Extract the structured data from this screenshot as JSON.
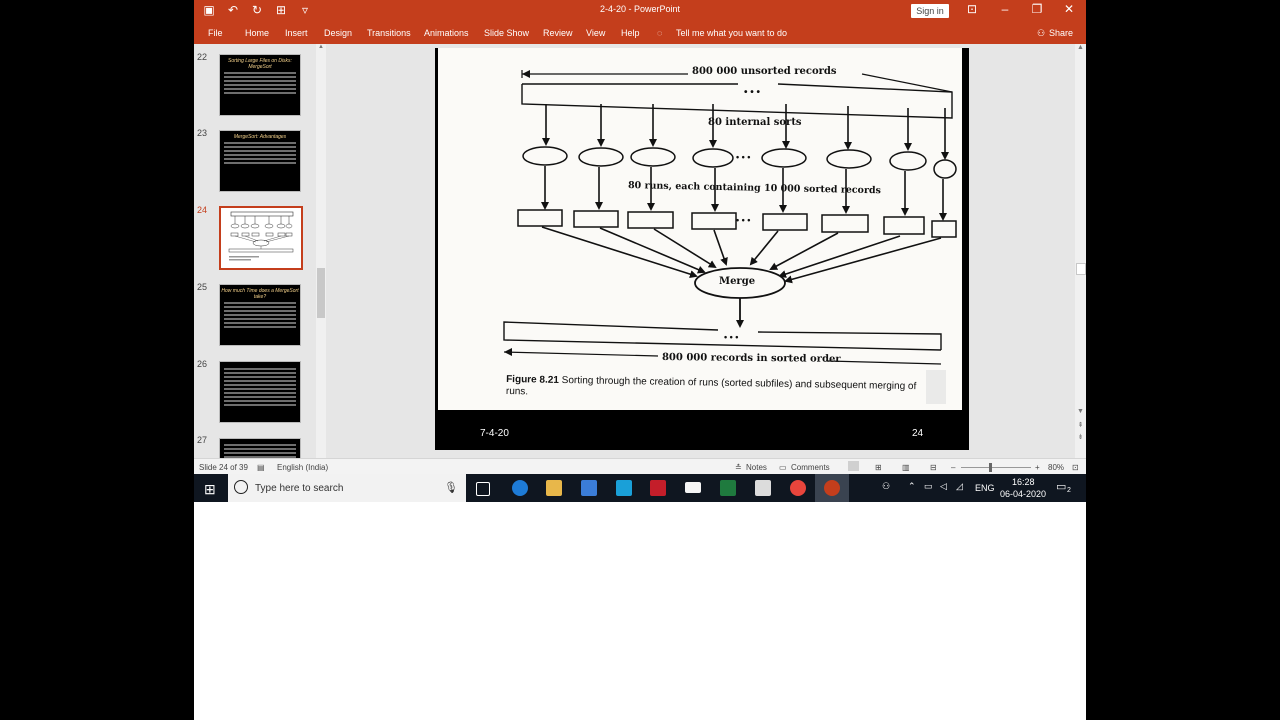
{
  "window": {
    "title": "2-4-20  -  PowerPoint",
    "sign_in": "Sign in"
  },
  "ribbon": {
    "tabs": [
      "File",
      "Home",
      "Insert",
      "Design",
      "Transitions",
      "Animations",
      "Slide Show",
      "Review",
      "View",
      "Help"
    ],
    "tell_me": "Tell me what you want to do",
    "share": "Share"
  },
  "thumbnails": [
    {
      "num": "22",
      "title": "Sorting Large Files on Disks: MergeSort"
    },
    {
      "num": "23",
      "title": "MergeSort: Advantages"
    },
    {
      "num": "24",
      "title": ""
    },
    {
      "num": "25",
      "title": "How much Time does a MergeSort take?"
    },
    {
      "num": "26",
      "title": ""
    },
    {
      "num": "27",
      "title": ""
    }
  ],
  "slide": {
    "label_unsorted": "800 000 unsorted records",
    "label_internal": "80 internal sorts",
    "label_runs": "80 runs, each containing 10 000 sorted records",
    "label_merge": "Merge",
    "label_sorted": "800 000 records in sorted order",
    "dots": "• • •",
    "caption_fig": "Figure 8.21",
    "caption_text": "Sorting through the creation of runs (sorted subfiles) and subsequent merging of runs.",
    "footer_date": "7-4-20",
    "footer_page": "24"
  },
  "status": {
    "slide_info": "Slide 24 of 39",
    "language": "English (India)",
    "notes": "Notes",
    "comments": "Comments",
    "zoom": "80%"
  },
  "taskbar": {
    "search_placeholder": "Type here to search",
    "lang": "ENG",
    "time": "16:28",
    "date": "06-04-2020",
    "notif_count": "2"
  }
}
